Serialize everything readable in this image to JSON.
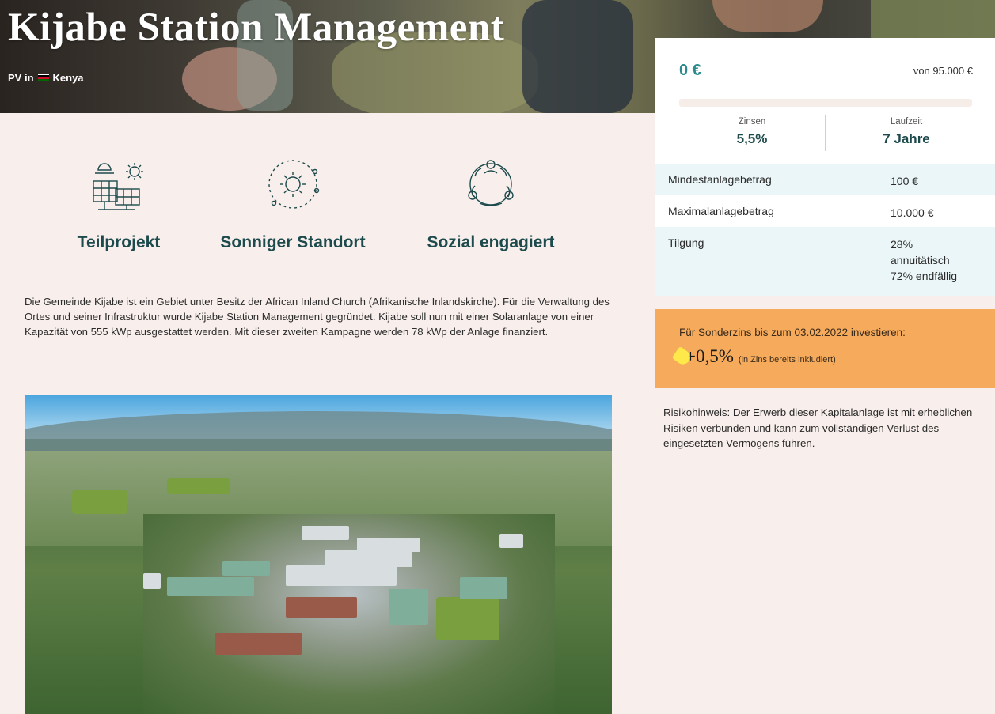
{
  "hero": {
    "title": "Kijabe Station Management",
    "subtitle_prefix": "PV in",
    "country": "Kenya"
  },
  "features": [
    {
      "label": "Teilprojekt",
      "icon": "solar-panel-icon"
    },
    {
      "label": "Sonniger Standort",
      "icon": "sun-icon"
    },
    {
      "label": "Sozial engagiert",
      "icon": "community-icon"
    }
  ],
  "description": "Die Gemeinde Kijabe ist ein Gebiet unter Besitz der African Inland Church (Afrikanische Inlandskirche). Für die Verwaltung des Ortes und seiner Infrastruktur wurde Kijabe Station Management gegründet. Kijabe soll nun mit einer Solaranlage von einer Kapazität von 555 kWp ausgestattet werden. Mit dieser zweiten Kampagne werden 78 kWp der Anlage finanziert.",
  "investment": {
    "amount": "0 €",
    "goal": "von 95.000 €",
    "progress_fraction": 0,
    "rate_label": "Zinsen",
    "rate_value": "5,5%",
    "term_label": "Laufzeit",
    "term_value": "7 Jahre",
    "rows": [
      {
        "key": "Mindestanlagebetrag",
        "value": "100 €"
      },
      {
        "key": "Maximalanlagebetrag",
        "value": "10.000 €"
      },
      {
        "key": "Tilgung",
        "value_lines": [
          "28%",
          "annuitätisch",
          "72% endfällig"
        ]
      }
    ]
  },
  "promo": {
    "text": "Für Sonderzins bis zum 03.02.2022 investieren:",
    "bonus": "+0,5%",
    "note": "(in Zins bereits inkludiert)"
  },
  "risk": "Risikohinweis: Der Erwerb dieser Kapitalanlage ist mit erheblichen Risiken verbunden und kann zum vollständigen Verlust des eingesetzten Vermögens führen.",
  "colors": {
    "background": "#f8efec",
    "teal": "#2a8a8e",
    "dark_teal": "#1d4a4c",
    "row_highlight": "#ebf6f8",
    "promo": "#f6ab5c",
    "tag": "#ffe84a"
  }
}
